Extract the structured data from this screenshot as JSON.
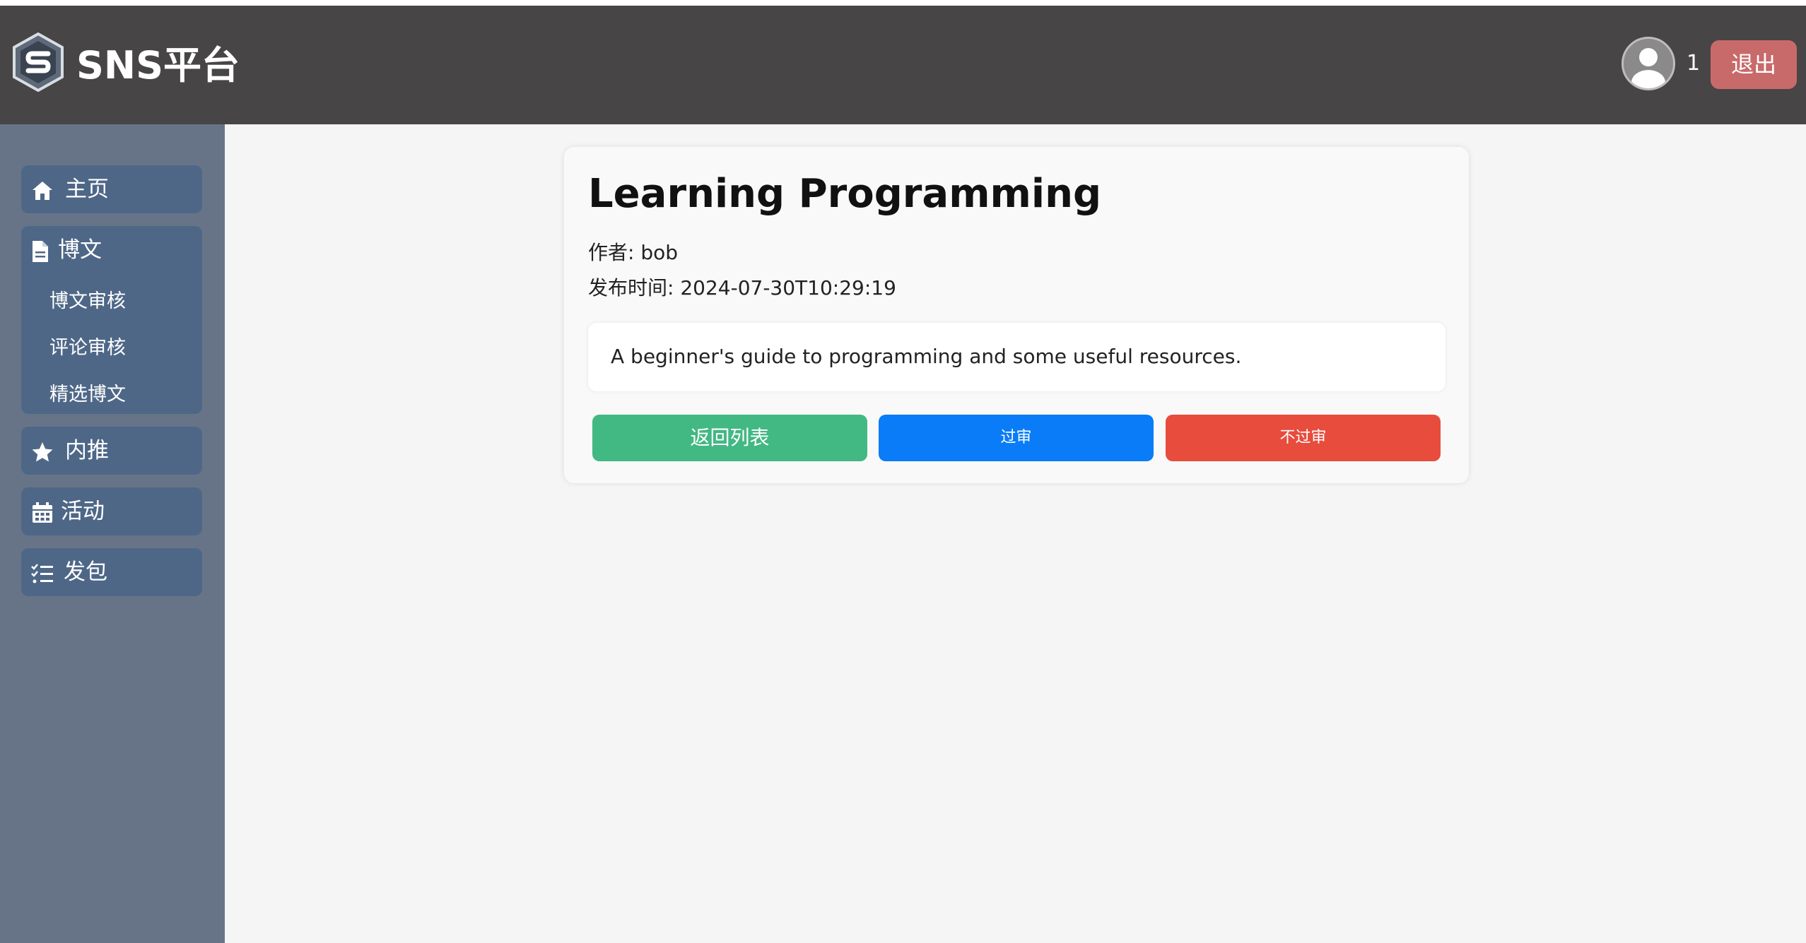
{
  "header": {
    "brand": "SNS平台",
    "user_count": "1",
    "logout_label": "退出"
  },
  "sidebar": {
    "items": [
      {
        "label": "主页",
        "icon": "home-icon"
      },
      {
        "label": "博文",
        "icon": "document-icon",
        "children": [
          "博文审核",
          "评论审核",
          "精选博文"
        ]
      },
      {
        "label": "内推",
        "icon": "star-icon"
      },
      {
        "label": "活动",
        "icon": "calendar-icon"
      },
      {
        "label": "发包",
        "icon": "checklist-icon"
      }
    ]
  },
  "post": {
    "title": "Learning Programming",
    "author_line": "作者: bob",
    "time_line": "发布时间: 2024-07-30T10:29:19",
    "content": "A beginner's guide to programming and some useful resources."
  },
  "actions": {
    "back_label": "返回列表",
    "approve_label": "过审",
    "reject_label": "不过审"
  },
  "colors": {
    "header_bg": "#474546",
    "sidebar_bg": "#677487",
    "nav_item_bg": "#4e6787",
    "logout_bg": "#c96a6a",
    "back_btn": "#42b883",
    "approve_btn": "#0a7cf7",
    "reject_btn": "#e74c3c"
  }
}
